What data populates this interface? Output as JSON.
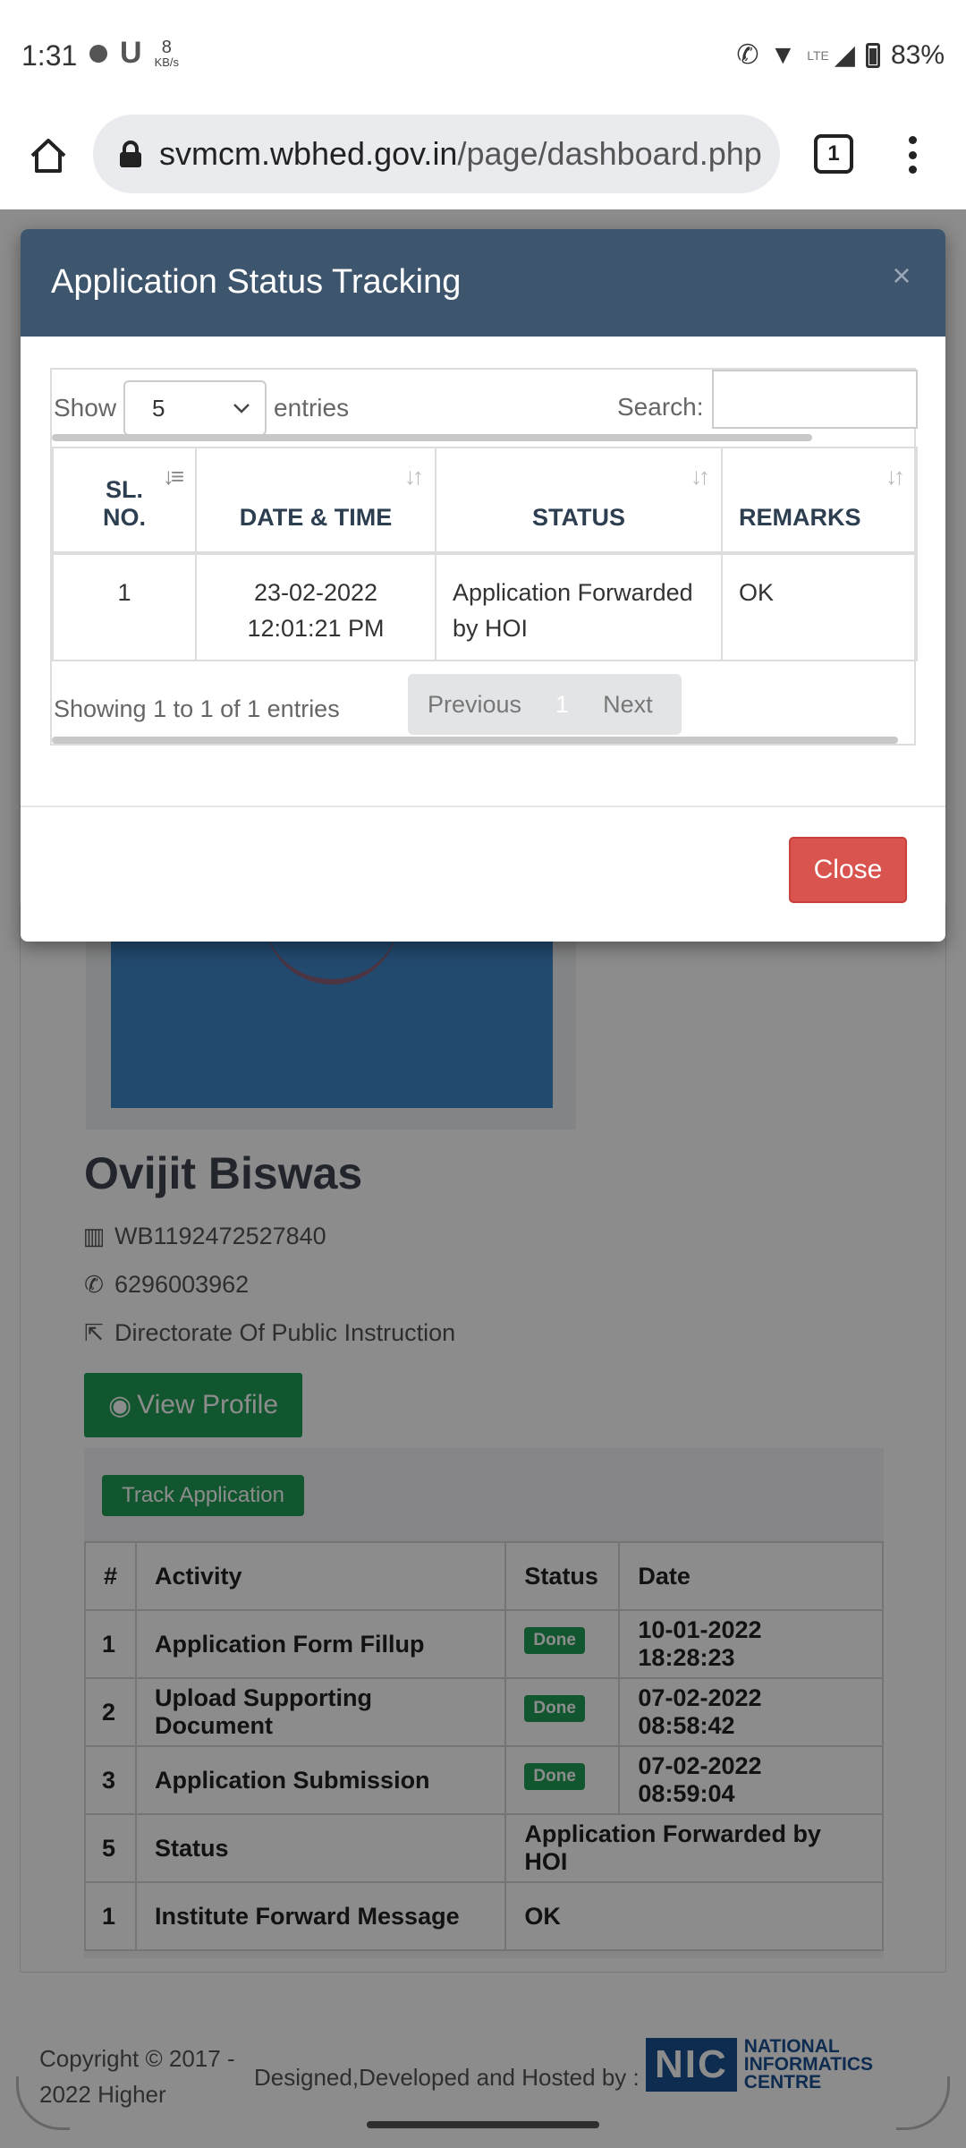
{
  "status_bar": {
    "time": "1:31",
    "net_speed_value": "8",
    "net_speed_unit": "KB/s",
    "network_type": "LTE",
    "battery": "83%"
  },
  "browser": {
    "url_host": "svmcm.wbhed.gov.in",
    "url_path": "/page/dashboard.php",
    "tab_count": "1"
  },
  "profile": {
    "name": "Ovijit Biswas",
    "id": "WB1192472527840",
    "phone": "6296003962",
    "institute": "Directorate Of Public Instruction",
    "view_profile_label": "View Profile"
  },
  "track": {
    "button_label": "Track Application",
    "headers": [
      "#",
      "Activity",
      "Status",
      "Date"
    ],
    "rows": [
      {
        "num": "1",
        "activity": "Application Form Fillup",
        "status": "Done",
        "date": "10-01-2022 18:28:23"
      },
      {
        "num": "2",
        "activity": "Upload Supporting Document",
        "status": "Done",
        "date": "07-02-2022 08:58:42"
      },
      {
        "num": "3",
        "activity": "Application Submission",
        "status": "Done",
        "date": "07-02-2022 08:59:04"
      },
      {
        "num": "5",
        "activity": "Status",
        "value": "Application Forwarded by HOI"
      },
      {
        "num": "1",
        "activity": "Institute Forward Message",
        "value": "OK"
      }
    ]
  },
  "footer": {
    "copyright": "Copyright © 2017 - 2022 Higher",
    "hosted_by": "Designed,Developed and Hosted by :",
    "logo_mark": "NIC",
    "logo_text_1": "NATIONAL",
    "logo_text_2": "INFORMATICS",
    "logo_text_3": "CENTRE"
  },
  "modal": {
    "title": "Application Status Tracking",
    "close_x": "×",
    "show_label": "Show",
    "entries_value": "5",
    "entries_label": "entries",
    "search_label": "Search:",
    "search_value": "",
    "columns": {
      "sl_1": "SL.",
      "sl_2": "NO.",
      "datetime": "DATE & TIME",
      "status": "STATUS",
      "remarks": "REMARKS"
    },
    "row": {
      "sl": "1",
      "date": "23-02-2022",
      "time": "12:01:21 PM",
      "status_1": "Application Forwarded",
      "status_2": "by HOI",
      "remarks": "OK"
    },
    "info": "Showing 1 to 1 of 1 entries",
    "prev_label": "Previous",
    "page_label": "1",
    "next_label": "Next",
    "close_label": "Close"
  },
  "colors": {
    "modal_header": "#3d556d",
    "close_button": "#d9534f",
    "success_green": "#1f9d55",
    "nic_blue": "#1b4f92"
  }
}
